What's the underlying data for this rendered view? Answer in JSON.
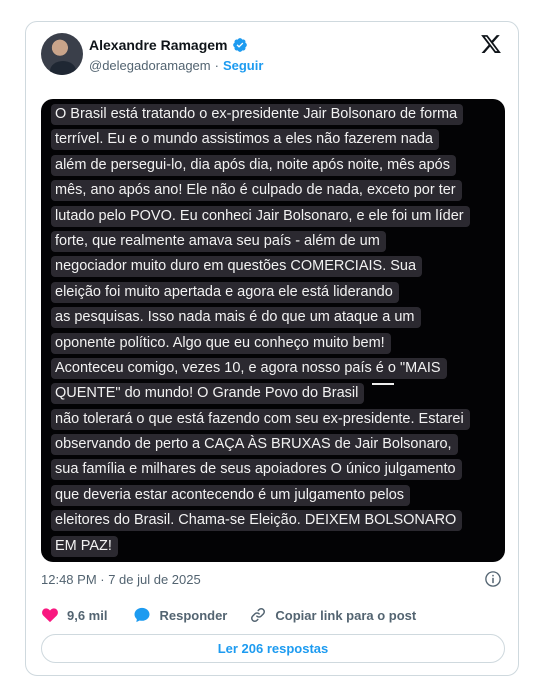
{
  "author": {
    "name": "Alexandre Ramagem",
    "handle": "@delegadoramagem",
    "separator": "·",
    "follow_label": "Seguir"
  },
  "media_text_lines": [
    "O Brasil está tratando o ex-presidente Jair Bolsonaro de forma",
    "terrível. Eu e o mundo assistimos a eles não fazerem nada",
    "além de persegui-lo, dia após dia, noite após noite, mês após",
    "mês, ano após ano! Ele não é culpado de nada, exceto por ter",
    "lutado pelo POVO. Eu conheci Jair Bolsonaro, e ele foi um líder",
    "forte, que realmente amava seu país - além de um",
    "negociador muito duro em questões COMERCIAIS. Sua",
    "eleição foi muito apertada e agora ele está liderando",
    "as pesquisas. Isso nada mais é do que um ataque a um",
    "oponente político. Algo que eu conheço muito bem!",
    "Aconteceu comigo, vezes 10, e agora nosso país é o \"MAIS",
    "QUENTE\" do mundo! O Grande Povo do Brasil",
    "não tolerará o que está fazendo com seu ex-presidente. Estarei",
    "observando de perto a CAÇA ÀS BRUXAS de Jair Bolsonaro,",
    "sua família e milhares de seus apoiadores O único julgamento",
    "que deveria estar acontecendo é um julgamento pelos",
    "eleitores do Brasil. Chama-se Eleição. DEIXEM BOLSONARO",
    "EM PAZ!"
  ],
  "timestamp": "12:48 PM · 7 de jul de 2025",
  "actions": {
    "likes": "9,6 mil",
    "reply_label": "Responder",
    "copy_link_label": "Copiar link para o post"
  },
  "read_replies_label": "Ler 206 respostas",
  "icons": {
    "verified": "verified-badge-icon",
    "logo": "x-logo-icon",
    "info": "info-icon",
    "like": "heart-icon",
    "reply": "speech-bubble-icon",
    "copy": "link-icon"
  },
  "colors": {
    "accent": "#1d9bf0",
    "like": "#f91880",
    "text_secondary": "#536471"
  }
}
